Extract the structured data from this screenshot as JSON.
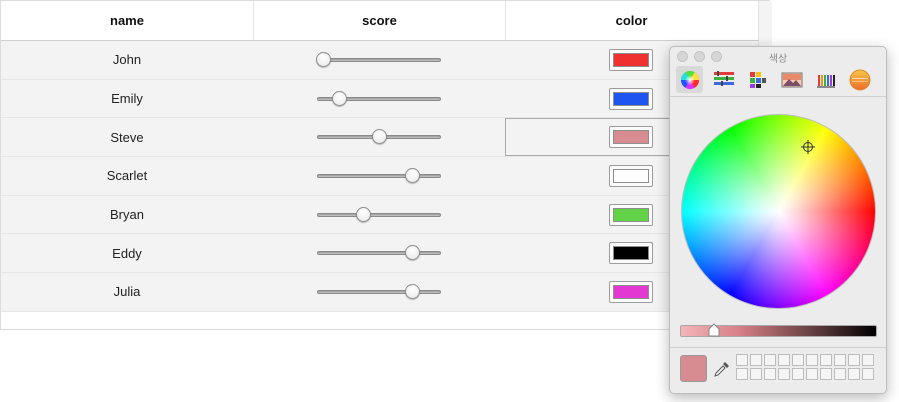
{
  "table": {
    "columns": [
      "name",
      "score",
      "color"
    ],
    "rows": [
      {
        "name": "John",
        "score": 0.05,
        "color": "#ef3230"
      },
      {
        "name": "Emily",
        "score": 0.18,
        "color": "#1e55f0"
      },
      {
        "name": "Steve",
        "score": 0.5,
        "color": "#d68c91"
      },
      {
        "name": "Scarlet",
        "score": 0.77,
        "color": "#ffffff"
      },
      {
        "name": "Bryan",
        "score": 0.37,
        "color": "#62d347"
      },
      {
        "name": "Eddy",
        "score": 0.77,
        "color": "#000000"
      },
      {
        "name": "Julia",
        "score": 0.77,
        "color": "#e338d2"
      }
    ],
    "selected_row": 2
  },
  "color_panel": {
    "title": "색상",
    "tabs": [
      "color-wheel-icon",
      "color-sliders-icon",
      "color-palettes-icon",
      "image-palettes-icon",
      "pencils-icon",
      "crayon-icon"
    ],
    "active_tab": 0,
    "current_color": "#d68c91",
    "brightness": 0.17
  }
}
